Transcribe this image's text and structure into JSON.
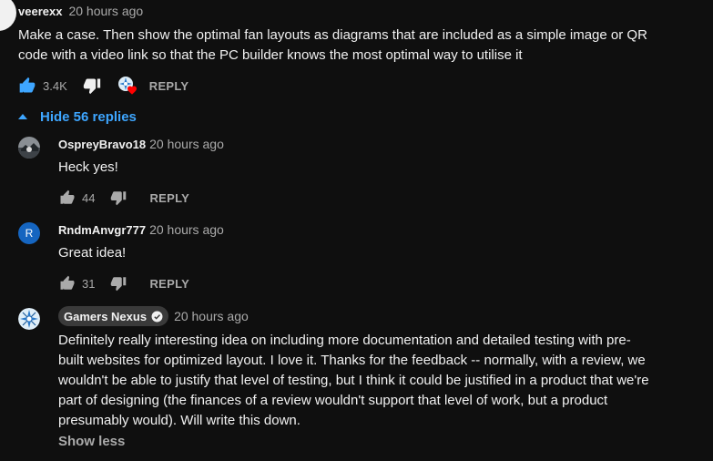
{
  "top_comment": {
    "author": "veerexx",
    "time": "20 hours ago",
    "text_line1": "Make a case. Then show the optimal fan layouts as diagrams that are included as a simple image or QR",
    "text_line2": "code with a video link so that the PC builder knows the most optimal way to utilise it",
    "likes": "3.4K",
    "reply_label": "REPLY"
  },
  "replies_toggle": {
    "label": "Hide 56 replies"
  },
  "replies": [
    {
      "author": "OspreyBravo18",
      "time": "20 hours ago",
      "text": "Heck yes!",
      "likes": "44",
      "reply_label": "REPLY"
    },
    {
      "author": "RndmAnvgr777",
      "time": "20 hours ago",
      "text": "Great idea!",
      "likes": "31",
      "reply_label": "REPLY",
      "avatar_letter": "R"
    },
    {
      "author": "Gamers Nexus",
      "time": "20 hours ago",
      "text_lines": [
        "Definitely really interesting idea on including more documentation and detailed testing with pre-",
        "built websites for optimized layout. I love it. Thanks for the feedback -- normally, with a review, we",
        "wouldn't be able to justify that level of testing, but I think it could be justified in a product that we're",
        "part of designing (the finances of a review wouldn't support that level of work, but a product",
        "presumably would). Will write this down."
      ],
      "show_less": "Show less"
    }
  ],
  "colors": {
    "background": "#0f0f0f",
    "link_blue": "#3ea6ff",
    "muted_text": "#aaaaaa",
    "avatar_blue": "#1565c0"
  }
}
